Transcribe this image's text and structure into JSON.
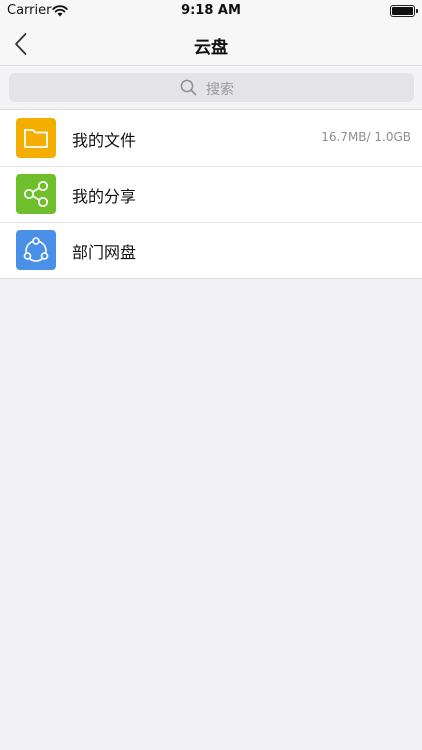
{
  "status_bar": {
    "carrier": "Carrier",
    "time": "9:18 AM",
    "icons": [
      "wifi-icon",
      "battery-icon"
    ]
  },
  "nav": {
    "title": "云盘",
    "back_icon": "chevron-left-icon"
  },
  "search": {
    "placeholder": "搜索",
    "icon": "search-icon"
  },
  "list": {
    "items": [
      {
        "label": "我的文件",
        "detail": "16.7MB/ 1.0GB",
        "icon": "folder-icon",
        "color": "#f4ae00"
      },
      {
        "label": "我的分享",
        "detail": "",
        "icon": "share-icon",
        "color": "#6ebf2b"
      },
      {
        "label": "部门网盘",
        "detail": "",
        "icon": "department-network-icon",
        "color": "#4a90e8"
      }
    ]
  },
  "colors": {
    "background": "#f1f1f3",
    "bar": "#f7f7f7",
    "row": "#ffffff"
  }
}
